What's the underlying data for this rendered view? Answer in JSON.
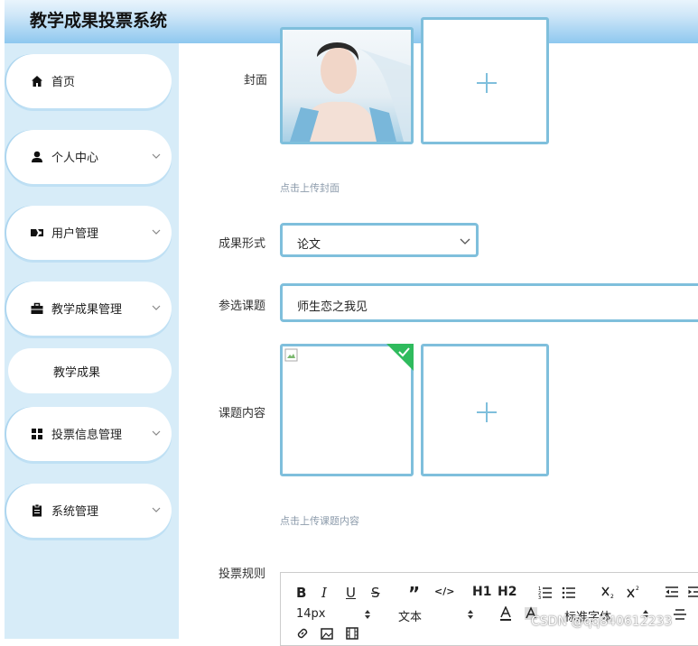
{
  "app": {
    "title": "教学成果投票系统"
  },
  "sidebar": {
    "items": [
      {
        "label": "首页",
        "icon": "home-icon",
        "has_chevron": false
      },
      {
        "label": "个人中心",
        "icon": "user-icon",
        "has_chevron": true
      },
      {
        "label": "用户管理",
        "icon": "user-card-icon",
        "has_chevron": true
      },
      {
        "label": "教学成果管理",
        "icon": "briefcase-icon",
        "has_chevron": true
      },
      {
        "label": "投票信息管理",
        "icon": "grid-icon",
        "has_chevron": true
      },
      {
        "label": "系统管理",
        "icon": "clipboard-icon",
        "has_chevron": true
      }
    ],
    "submenu": {
      "label": "教学成果"
    }
  },
  "form": {
    "cover": {
      "label": "封面",
      "hint": "点击上传封面"
    },
    "form_type": {
      "label": "成果形式",
      "value": "论文"
    },
    "topic": {
      "label": "参选课题",
      "value": "师生恋之我见"
    },
    "topic_content": {
      "label": "课题内容",
      "hint": "点击上传课题内容"
    },
    "vote_rules": {
      "label": "投票规则"
    }
  },
  "editor": {
    "row1": [
      "B",
      "I",
      "U",
      "S",
      "”",
      "</>",
      "H1",
      "H2"
    ],
    "font_size": "14px",
    "paragraph": "文本",
    "font_family": "标准字体"
  },
  "watermark": "CSDN @qq840612233",
  "colors": {
    "accent": "#7fbfdc",
    "sidebar_bg": "#d7ecf8",
    "success": "#2fbb5d"
  }
}
